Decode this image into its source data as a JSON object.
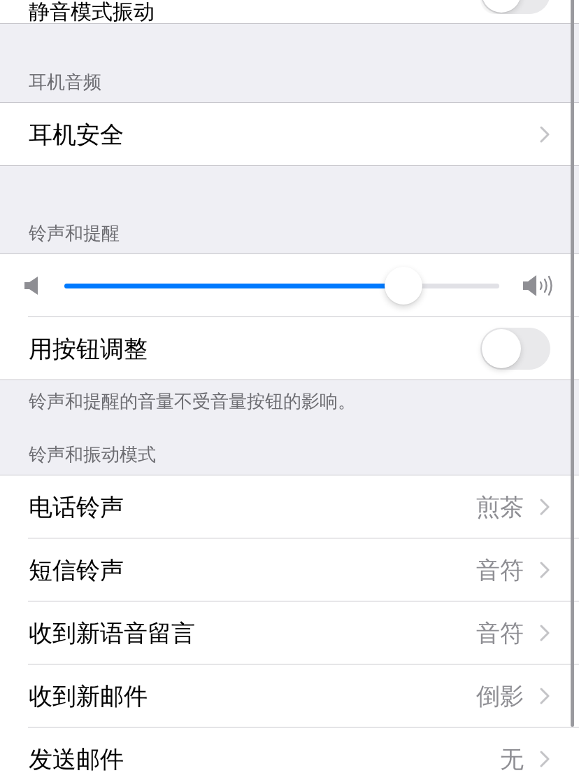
{
  "top_row": {
    "label": "静音模式振动",
    "on": false
  },
  "sections": [
    {
      "header": "耳机音频",
      "rows": [
        {
          "kind": "link",
          "label": "耳机安全"
        }
      ]
    },
    {
      "header": "铃声和提醒",
      "rows": [
        {
          "kind": "slider",
          "level": 0.78
        },
        {
          "kind": "toggle",
          "label": "用按钮调整",
          "on": false
        }
      ],
      "footer": "铃声和提醒的音量不受音量按钮的影响。"
    },
    {
      "header": "铃声和振动模式",
      "rows": [
        {
          "kind": "link",
          "label": "电话铃声",
          "value": "煎茶"
        },
        {
          "kind": "link",
          "label": "短信铃声",
          "value": "音符"
        },
        {
          "kind": "link",
          "label": "收到新语音留言",
          "value": "音符"
        },
        {
          "kind": "link",
          "label": "收到新邮件",
          "value": "倒影"
        },
        {
          "kind": "link",
          "label": "发送邮件",
          "value": "无"
        }
      ]
    }
  ]
}
